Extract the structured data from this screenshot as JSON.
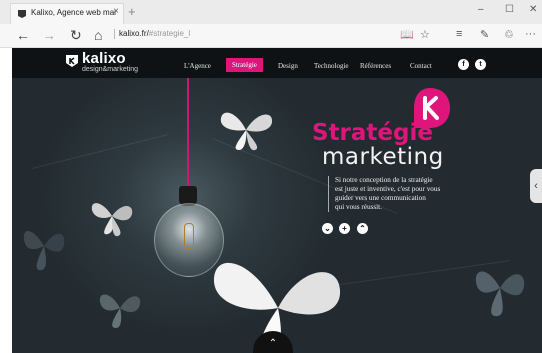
{
  "browser": {
    "tab_title": "Kalixo, Agence web mar",
    "tab_close": "×",
    "new_tab": "+",
    "window_controls": {
      "minimize": "–",
      "maximize": "☐",
      "close": "✕"
    },
    "nav": {
      "back": "←",
      "forward": "→",
      "refresh": "↻",
      "home": "⌂"
    },
    "url_domain": "kalixo.fr/",
    "url_path": "#strategie_l",
    "tools": {
      "reading_view": "📖",
      "favorites": "☆",
      "hub": "≡",
      "notes": "✎",
      "share": "♲",
      "more": "···"
    }
  },
  "site": {
    "logo": {
      "name": "kalixo",
      "tagline": "design&marketing"
    },
    "menu": [
      {
        "label": "L'Agence",
        "active": false
      },
      {
        "label": "Stratégie",
        "active": true
      },
      {
        "label": "Design",
        "active": false
      },
      {
        "label": "Technologie",
        "active": false
      },
      {
        "label": "Références",
        "active": false
      },
      {
        "label": "Contact",
        "active": false
      }
    ],
    "social": {
      "facebook": "f",
      "twitter": "t"
    },
    "hero": {
      "headline": "Stratégie",
      "subhead": "marketing",
      "copy_lines": [
        "Si notre conception de la stratégie",
        "est juste et inventive, c'est pour vous",
        "guider vers une communication",
        "qui vous réussit."
      ],
      "buttons": {
        "down": "⌄",
        "plus": "+",
        "up": "⌃"
      }
    },
    "side_tab": "‹",
    "scroll_top": "⌃"
  },
  "colors": {
    "accent": "#e0157c",
    "nav_bg": "#0f1214",
    "hero_bg": "#2e3a40"
  }
}
